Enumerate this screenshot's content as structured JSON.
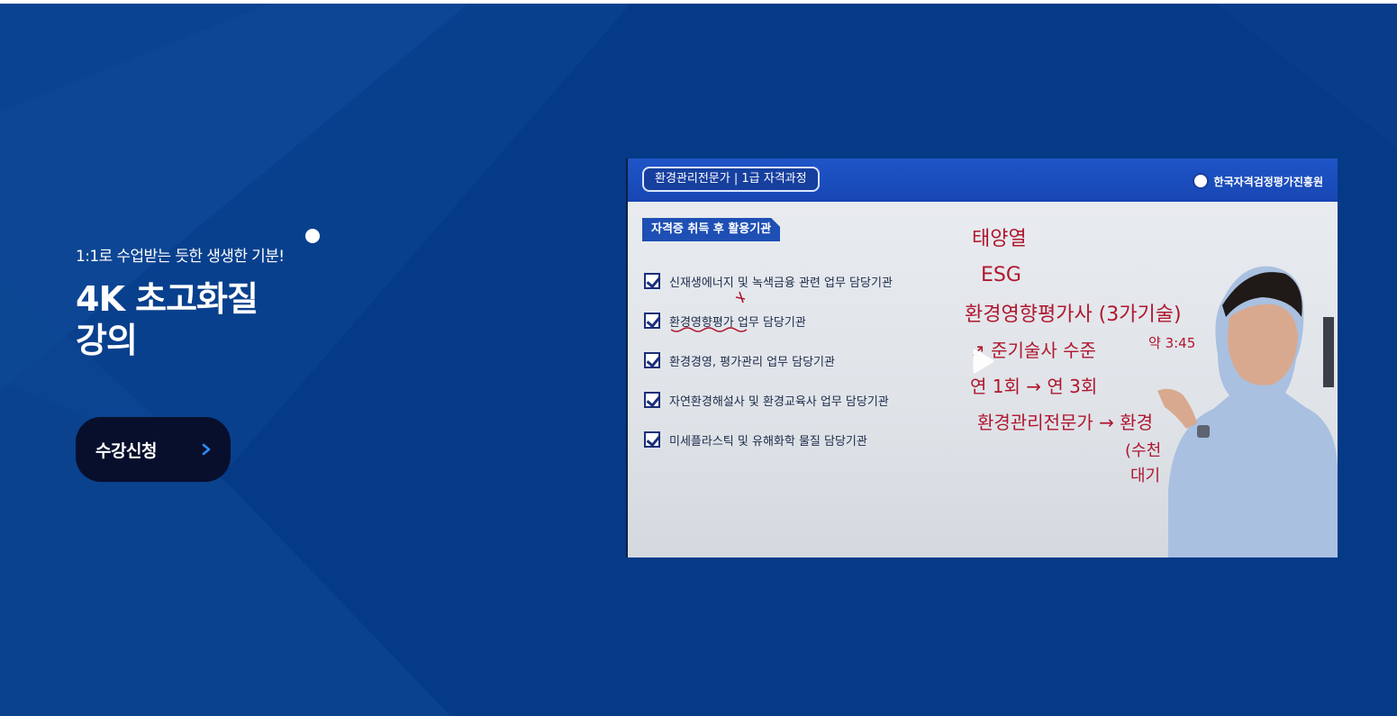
{
  "banner": {
    "subtitle": "1:1로 수업받는 듯한 생생한 기분!",
    "title_line1": "4K 초고화질",
    "title_line2": "강의",
    "cta_label": "수강신청"
  },
  "video": {
    "course_badge": "환경관리전문가 | 1급 자격과정",
    "org_name": "한국자격검정평가진흥원",
    "section_tag": "자격증 취득 후 활용기관",
    "items": [
      "신재생에너지 및 녹색금융 관련 업무 담당기관",
      "환경영향평가 업무 담당기관",
      "환경경영, 평가관리 업무 담당기관",
      "자연환경해설사 및 환경교육사 업무 담당기관",
      "미세플라스틱 및 유해화학 물질 담당기관"
    ],
    "handwriting": {
      "line1": "태양열",
      "line2": "ESG",
      "line3": "환경영향평가사 (3가기술)",
      "line3b": "약 3:45",
      "line4": "↗ 준기술사 수준",
      "line5": "연 1회 → 연 3회",
      "line6": "환경관리전문가 → 환경",
      "line7": "(수천",
      "line8": "대기"
    }
  },
  "colors": {
    "banner_bg": "#053a86",
    "cta_bg": "#070f2c",
    "cta_chevron": "#2f8bf0",
    "handwriting": "#b0172f"
  }
}
